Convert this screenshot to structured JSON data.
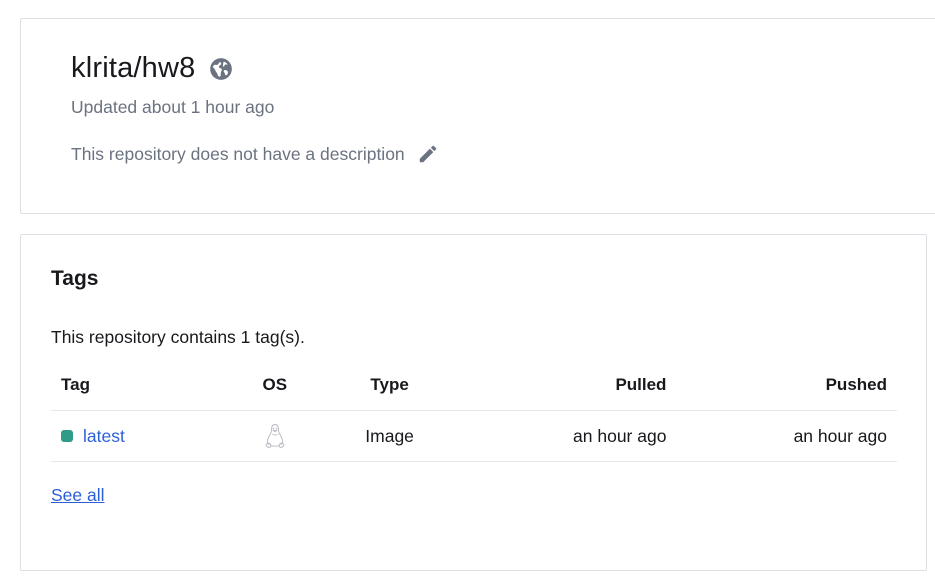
{
  "repo": {
    "name": "klrita/hw8",
    "updated": "Updated about 1 hour ago",
    "description": "This repository does not have a description"
  },
  "tags_section": {
    "heading": "Tags",
    "count_text": "This repository contains 1 tag(s).",
    "columns": {
      "tag": "Tag",
      "os": "OS",
      "type": "Type",
      "pulled": "Pulled",
      "pushed": "Pushed"
    },
    "rows": [
      {
        "tag": "latest",
        "os_icon": "linux-icon",
        "type": "Image",
        "pulled": "an hour ago",
        "pushed": "an hour ago",
        "status_color": "#2f9c8a"
      }
    ],
    "see_all": "See all"
  },
  "colors": {
    "link": "#2c5fd6",
    "muted_text": "#6b7280",
    "border": "#dcdfe3",
    "icon_gray": "#6b7280"
  },
  "icons": {
    "visibility": "globe-icon",
    "edit": "pencil-icon"
  }
}
